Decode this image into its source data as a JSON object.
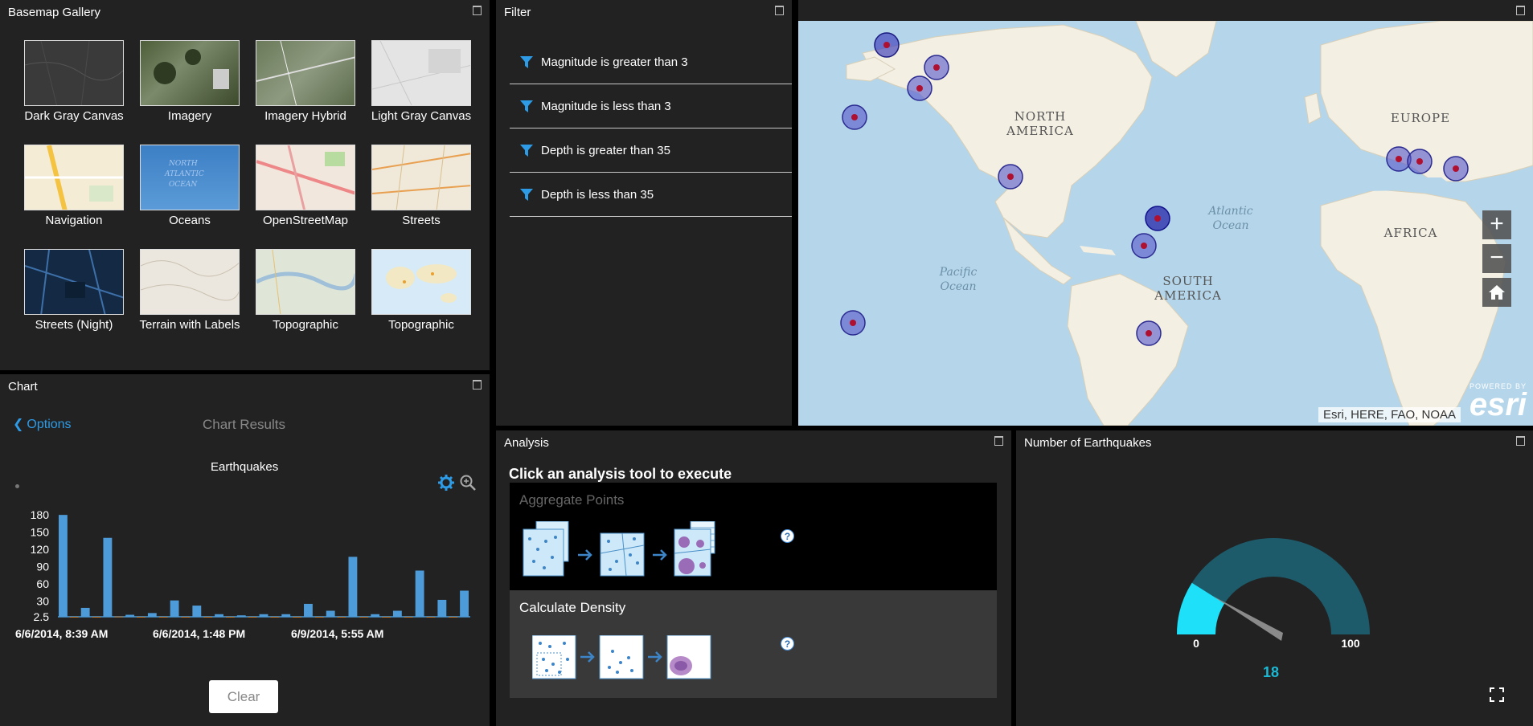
{
  "basemap_gallery": {
    "title": "Basemap Gallery",
    "items": [
      {
        "label": "Dark Gray Canvas"
      },
      {
        "label": "Imagery"
      },
      {
        "label": "Imagery Hybrid"
      },
      {
        "label": "Light Gray Canvas"
      },
      {
        "label": "Navigation"
      },
      {
        "label": "Oceans"
      },
      {
        "label": "OpenStreetMap"
      },
      {
        "label": "Streets"
      },
      {
        "label": "Streets (Night)"
      },
      {
        "label": "Terrain with Labels"
      },
      {
        "label": "Topographic"
      },
      {
        "label": "Topographic"
      }
    ]
  },
  "filter": {
    "title": "Filter",
    "items": [
      {
        "label": "Magnitude is greater than 3"
      },
      {
        "label": "Magnitude is less than 3"
      },
      {
        "label": "Depth is greater than 35"
      },
      {
        "label": "Depth is less than 35"
      }
    ]
  },
  "map": {
    "labels": {
      "north_america": "NORTH AMERICA",
      "south_america": "SOUTH AMERICA",
      "europe": "EUROPE",
      "africa": "AFRICA",
      "atlantic": "Atlantic Ocean",
      "pacific": "Pacific Ocean"
    },
    "attribution": "Esri, HERE, FAO, NOAA",
    "powered_by": "POWERED BY",
    "esri_logo": "esri",
    "zoom_in": "+",
    "zoom_out": "−"
  },
  "chart_panel": {
    "title": "Chart",
    "options_label": "Options",
    "results_label": "Chart Results",
    "clear_label": "Clear"
  },
  "chart_data": {
    "type": "bar",
    "title": "Earthquakes",
    "yticks": [
      "180",
      "150",
      "120",
      "90",
      "60",
      "30",
      "2.5"
    ],
    "xticks": [
      "6/6/2014, 8:39 AM",
      "6/6/2014, 1:48 PM",
      "6/9/2014, 5:55 AM"
    ],
    "ylim": [
      2.5,
      190
    ],
    "values": [
      180,
      2,
      18,
      2,
      140,
      3,
      6,
      2,
      9,
      2,
      31,
      2,
      22,
      2,
      7,
      2,
      5,
      2,
      7,
      2,
      7,
      2,
      25,
      2,
      13,
      2,
      107,
      2,
      7,
      2,
      13,
      2,
      83,
      2,
      32,
      2,
      48
    ],
    "colors": {
      "primary": "#4d9bd8",
      "alternate": "#c77a2c"
    }
  },
  "analysis": {
    "title": "Analysis",
    "instruction": "Click an analysis tool to execute",
    "tools": [
      {
        "name": "Aggregate Points",
        "help": "?"
      },
      {
        "name": "Calculate Density",
        "help": "?"
      }
    ]
  },
  "gauge": {
    "title": "Number of Earthquakes",
    "min": "0",
    "max": "100",
    "value": "18",
    "value_number": 18,
    "colors": {
      "fill": "#1ee0f8",
      "track": "#1d5b6b",
      "needle": "#8a8a8a"
    }
  }
}
